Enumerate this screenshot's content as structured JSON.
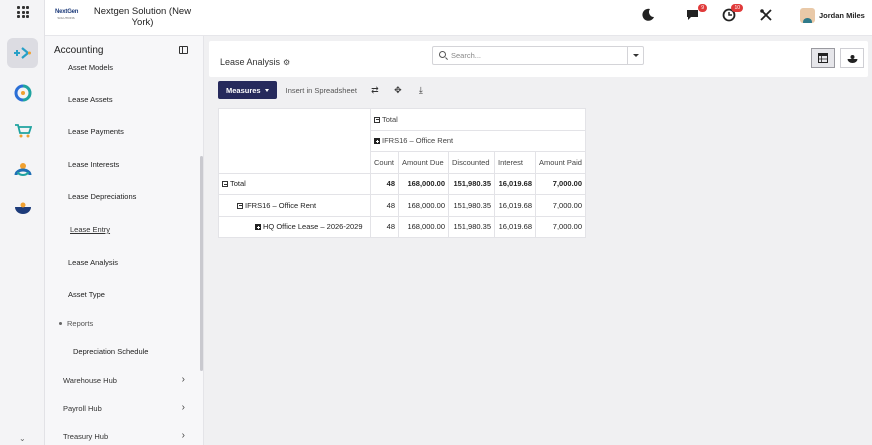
{
  "header": {
    "brand_logo_text": "NextGen",
    "brand_logo_sub": "SOLUTIONS",
    "company": "Nextgen Solution (New York)",
    "chat_badge": "9",
    "activity_badge": "10",
    "user_name": "Jordan Miles"
  },
  "sidebar": {
    "title": "Accounting",
    "items": [
      {
        "label": "Asset Models"
      },
      {
        "label": "Lease Assets"
      },
      {
        "label": "Lease Payments"
      },
      {
        "label": "Lease Interests"
      },
      {
        "label": "Lease Depreciations"
      },
      {
        "label": "Lease Entry"
      },
      {
        "label": "Lease Analysis"
      },
      {
        "label": "Asset Type"
      }
    ],
    "reports_label": "Reports",
    "report_items": [
      {
        "label": "Depreciation Schedule"
      }
    ],
    "hubs": [
      {
        "label": "Warehouse Hub"
      },
      {
        "label": "Payroll Hub"
      },
      {
        "label": "Treasury Hub"
      }
    ]
  },
  "control_panel": {
    "title": "Lease Analysis",
    "search_placeholder": "Search..."
  },
  "toolbar": {
    "measures_label": "Measures",
    "insert_label": "Insert in Spreadsheet"
  },
  "pivot": {
    "col_total": "Total",
    "col_group": "IFRS16 – Office Rent",
    "measures": [
      "Count",
      "Amount Due",
      "Discounted",
      "Interest",
      "Amount Paid"
    ],
    "rows": [
      {
        "label": "Total",
        "values": [
          "48",
          "168,000.00",
          "151,980.35",
          "16,019.68",
          "7,000.00"
        ]
      },
      {
        "label": "IFRS16 – Office Rent",
        "values": [
          "48",
          "168,000.00",
          "151,980.35",
          "16,019.68",
          "7,000.00"
        ]
      },
      {
        "label": "HQ Office Lease – 2026-2029",
        "values": [
          "48",
          "168,000.00",
          "151,980.35",
          "16,019.68",
          "7,000.00"
        ]
      }
    ]
  },
  "colors": {
    "primary_button": "#262a5c",
    "badge": "#e03a3a"
  },
  "icons": [
    "apps-grid-icon",
    "moon-icon",
    "chat-icon",
    "activity-icon",
    "tools-icon",
    "gear-icon",
    "search-icon",
    "swap-icon",
    "expand-icon",
    "download-icon",
    "pivot-view-icon",
    "graph-view-icon",
    "chevron-right-icon",
    "chevron-down-icon"
  ]
}
